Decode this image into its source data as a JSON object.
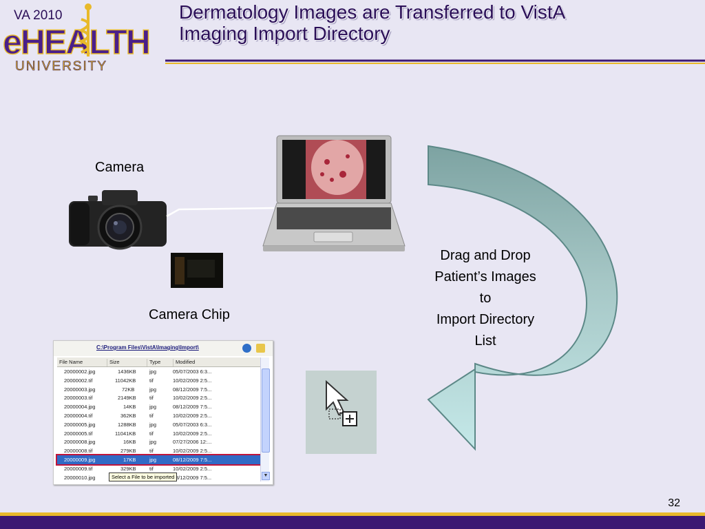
{
  "logo": {
    "year_text": "VA 2010",
    "main_text": "eHEALTH",
    "sub_text": "UNIVERSITY"
  },
  "slide": {
    "title_line1": "Dermatology Images are Transferred to VistA",
    "title_line2": "Imaging Import Directory",
    "page_number": "32"
  },
  "labels": {
    "camera": "Camera",
    "camera_chip": "Camera Chip",
    "drag_drop_lines": [
      "Drag and Drop",
      "Patient’s Images",
      "to",
      "Import Directory",
      "List"
    ]
  },
  "file_window": {
    "path": "C:\\Program Files\\VistA\\Imaging\\Import\\",
    "columns": [
      "File Name",
      "Size",
      "Type",
      "Modified"
    ],
    "rows": [
      {
        "name": "20000002.jpg",
        "size": "1436KB",
        "type": "jpg",
        "modified": "05/07/2003  6:3..."
      },
      {
        "name": "20000002.tif",
        "size": "11042KB",
        "type": "tif",
        "modified": "10/02/2009  2:5..."
      },
      {
        "name": "20000003.jpg",
        "size": "72KB",
        "type": "jpg",
        "modified": "08/12/2009  7:5..."
      },
      {
        "name": "20000003.tif",
        "size": "2149KB",
        "type": "tif",
        "modified": "10/02/2009  2:5..."
      },
      {
        "name": "20000004.jpg",
        "size": "14KB",
        "type": "jpg",
        "modified": "08/12/2009  7:5..."
      },
      {
        "name": "20000004.tif",
        "size": "362KB",
        "type": "tif",
        "modified": "10/02/2009  2:5..."
      },
      {
        "name": "20000005.jpg",
        "size": "1288KB",
        "type": "jpg",
        "modified": "05/07/2003  6:3..."
      },
      {
        "name": "20000005.tif",
        "size": "11041KB",
        "type": "tif",
        "modified": "10/02/2009  2:5..."
      },
      {
        "name": "20000008.jpg",
        "size": "16KB",
        "type": "jpg",
        "modified": "07/27/2006  12:..."
      },
      {
        "name": "20000008.tif",
        "size": "279KB",
        "type": "tif",
        "modified": "10/02/2009  2:5..."
      },
      {
        "name": "20000009.jpg",
        "size": "17KB",
        "type": "jpg",
        "modified": "08/12/2009  7:5..."
      },
      {
        "name": "20000009.tif",
        "size": "329KB",
        "type": "tif",
        "modified": "10/02/2009  2:5..."
      },
      {
        "name": "20000010.jpg",
        "size": "",
        "type": "",
        "modified": "8/12/2009  7:5..."
      }
    ],
    "tooltip": "Select a File to be imported"
  },
  "colors": {
    "background": "#e8e6f3",
    "title": "#2a0e57",
    "purple_bar": "#3b1873",
    "gold_bar": "#e8b92a",
    "arrow_top": "#7da3a2",
    "arrow_bottom": "#c4e8e8",
    "selection": "#316ac5",
    "highlight_border": "#c0143a"
  }
}
